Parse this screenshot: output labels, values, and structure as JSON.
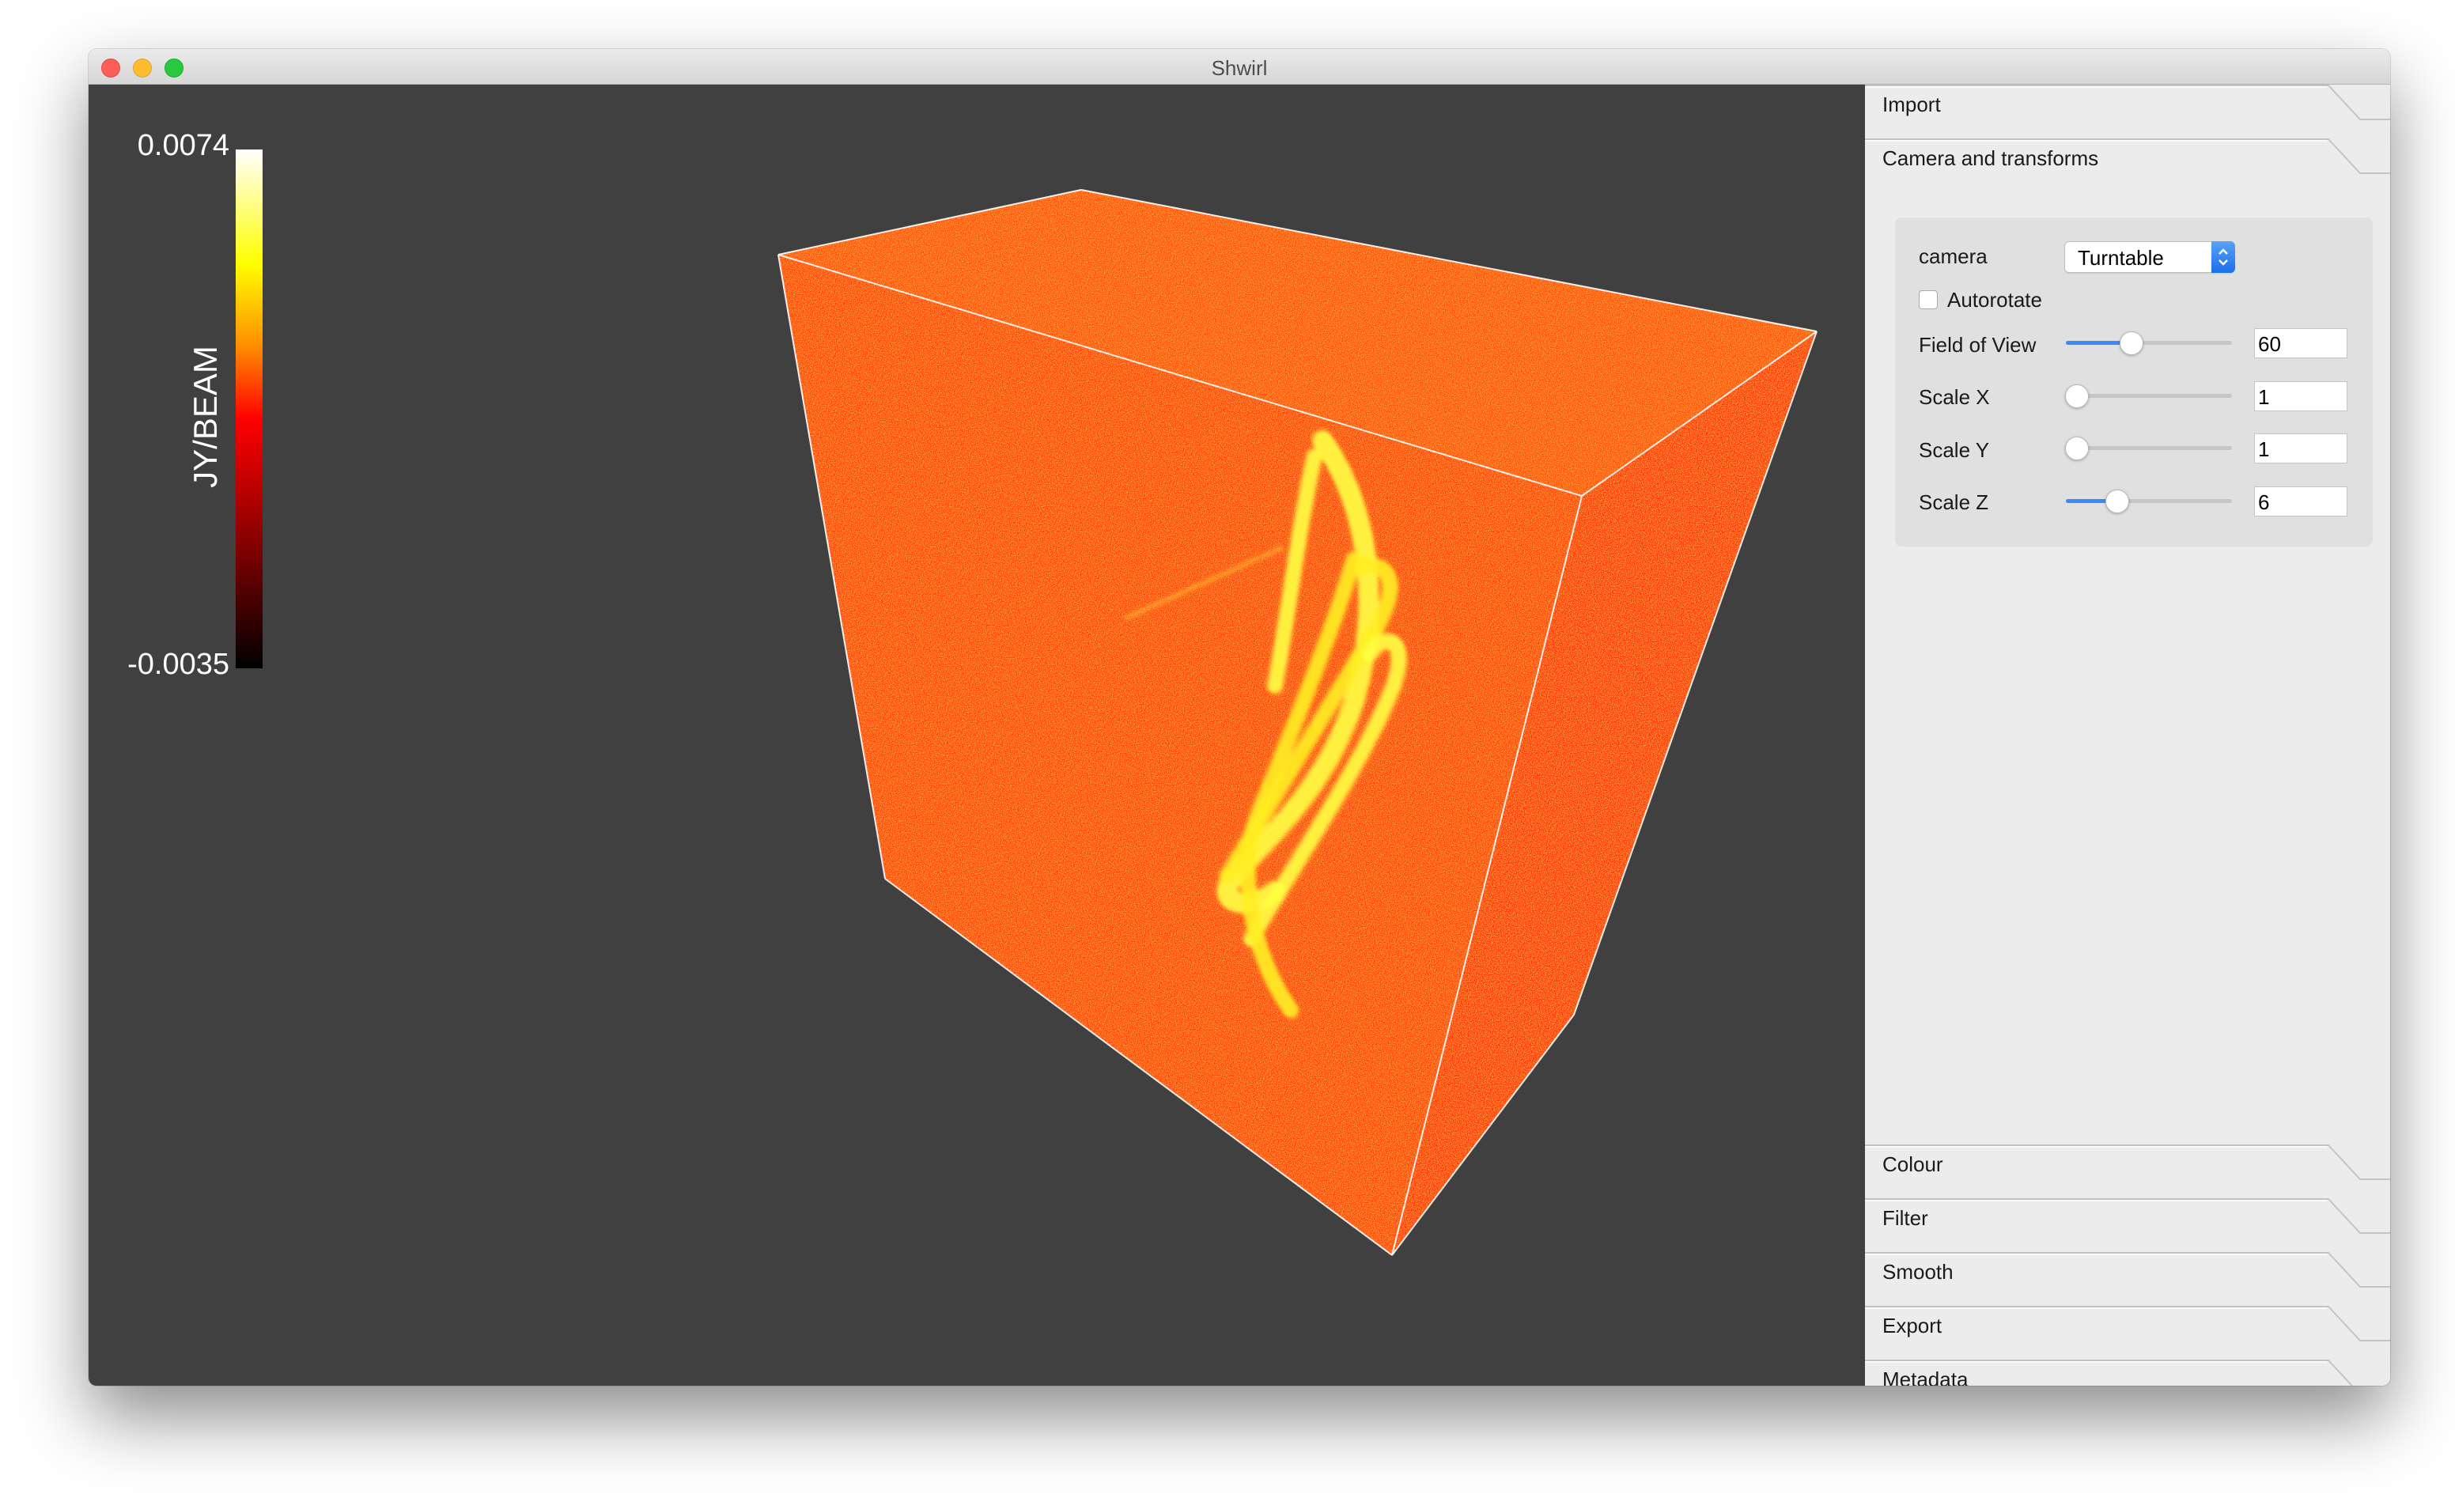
{
  "window": {
    "title": "Shwirl"
  },
  "colorbar": {
    "max_label": "0.0074",
    "min_label": "-0.0035",
    "unit_label": "JY/BEAM",
    "colormap": [
      "#000000",
      "#7a0000",
      "#ff0000",
      "#ff8c00",
      "#ffff00",
      "#ffffff"
    ]
  },
  "viewport": {
    "background": "#404040",
    "volume_color": "#ff3300",
    "highlight_color": "#ffff33"
  },
  "panel": {
    "sections_top": [
      {
        "label": "Import"
      },
      {
        "label": "Camera and transforms"
      }
    ],
    "camera": {
      "camera_label": "camera",
      "camera_value": "Turntable",
      "autorotate_label": "Autorotate",
      "autorotate_checked": false,
      "fov_label": "Field of View",
      "fov_value": "60",
      "fov_fraction": 0.38,
      "scale_x_label": "Scale X",
      "scale_x_value": "1",
      "scale_x_fraction": 0.0,
      "scale_y_label": "Scale Y",
      "scale_y_value": "1",
      "scale_y_fraction": 0.0,
      "scale_z_label": "Scale Z",
      "scale_z_value": "6",
      "scale_z_fraction": 0.28
    },
    "sections_bottom": [
      {
        "label": "Colour"
      },
      {
        "label": "Filter"
      },
      {
        "label": "Smooth"
      },
      {
        "label": "Export"
      },
      {
        "label": "Metadata"
      }
    ]
  },
  "colors": {
    "accent": "#3b8bf6"
  }
}
